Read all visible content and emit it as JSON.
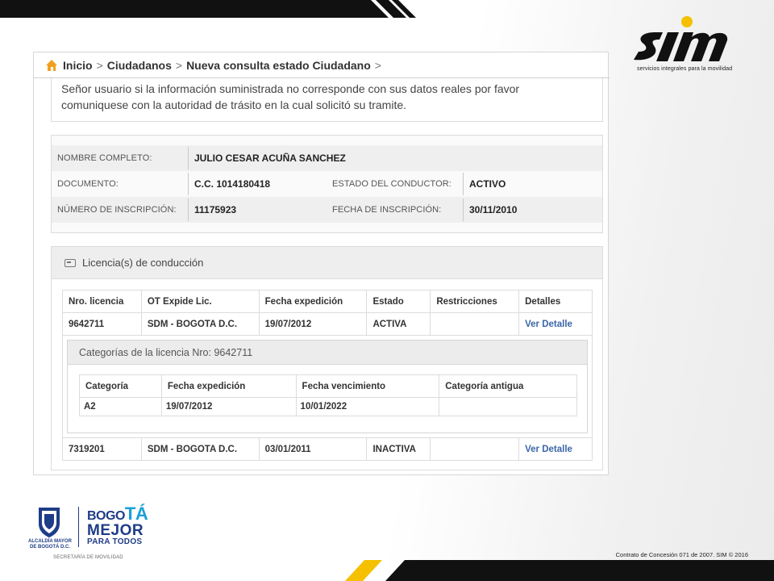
{
  "breadcrumb": {
    "home": "Inicio",
    "citizens": "Ciudadanos",
    "current": "Nueva consulta estado Ciudadano",
    "separator": ">"
  },
  "notice": {
    "line1": "Señor usuario si la información suministrada no corresponde con sus datos reales por favor",
    "line2": "comuniquese con la autoridad de trásito en la cual solicitó su tramite."
  },
  "person": {
    "name_label": "NOMBRE COMPLETO:",
    "name_value": "JULIO CESAR ACUÑA SANCHEZ",
    "document_label": "DOCUMENTO:",
    "document_value": "C.C. 1014180418",
    "status_label": "ESTADO DEL CONDUCTOR:",
    "status_value": "ACTIVO",
    "inscription_label": "NÚMERO DE INSCRIPCIÓN:",
    "inscription_value": "11175923",
    "date_label": "FECHA DE INSCRIPCIÓN:",
    "date_value": "30/11/2010"
  },
  "licenses": {
    "title": "Licencia(s) de conducción",
    "headers": [
      "Nro. licencia",
      "OT Expide Lic.",
      "Fecha expedición",
      "Estado",
      "Restricciones",
      "Detalles"
    ],
    "rows": [
      {
        "number": "9642711",
        "issuer": "SDM - BOGOTA D.C.",
        "issued": "19/07/2012",
        "status": "ACTIVA",
        "restrictions": "",
        "details": "Ver Detalle"
      },
      {
        "number": "7319201",
        "issuer": "SDM - BOGOTA D.C.",
        "issued": "03/01/2011",
        "status": "INACTIVA",
        "restrictions": "",
        "details": "Ver Detalle"
      }
    ],
    "categories": {
      "title": "Categorías de la licencia Nro: 9642711",
      "headers": [
        "Categoría",
        "Fecha expedición",
        "Fecha vencimiento",
        "Categoría antigua"
      ],
      "rows": [
        {
          "category": "A2",
          "issued": "19/07/2012",
          "expires": "10/01/2022",
          "old": ""
        }
      ]
    }
  },
  "branding": {
    "sim_word": "sim",
    "sim_tagline": "servicios integrales para la movilidad",
    "alcaldia_line1": "ALCALDÍA MAYOR",
    "alcaldia_line2": "DE BOGOTÁ D.C.",
    "bogota_pre": "BOGO",
    "bogota_ta": "TÁ",
    "bogota_mejor": "MEJOR",
    "bogota_todos": "PARA TODOS",
    "secretaria": "SECRETARÍA DE MOVILIDAD",
    "contract": "Contrato de Concesión 071 de 2007. SIM © 2016"
  },
  "colors": {
    "sim_yellow": "#f5c000",
    "link_blue": "#3a66a8",
    "home_orange": "#f0a020",
    "bogota_blue": "#1f3c88"
  }
}
